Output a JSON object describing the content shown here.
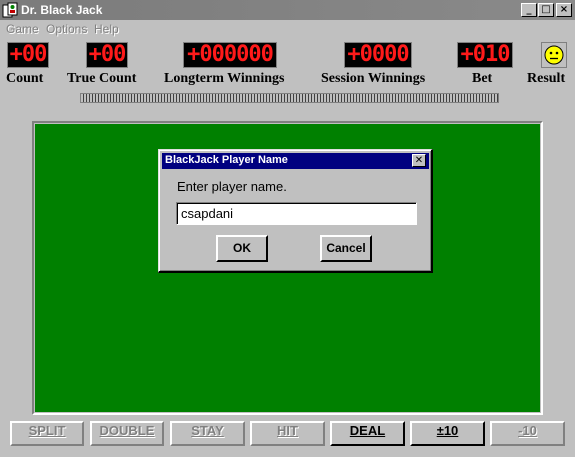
{
  "window": {
    "title": "Dr. Black Jack",
    "minimize_glyph": "_",
    "maximize_glyph": "□",
    "close_glyph": "×"
  },
  "menu": {
    "items": [
      "Game",
      "Options",
      "Help"
    ]
  },
  "displays": {
    "count": {
      "label": "Count",
      "value": "+00"
    },
    "true_count": {
      "label": "True Count",
      "value": "+00"
    },
    "longterm_winnings": {
      "label": "Longterm Winnings",
      "value": "+000000"
    },
    "session_winnings": {
      "label": "Session Winnings",
      "value": "+0000"
    },
    "bet": {
      "label": "Bet",
      "value": "+010"
    },
    "result": {
      "label": "Result",
      "icon": "neutral-face-icon"
    }
  },
  "dialog": {
    "title": "BlackJack Player Name",
    "prompt": "Enter player name.",
    "input_value": "csapdani",
    "ok_label": "OK",
    "cancel_label": "Cancel"
  },
  "buttons": {
    "split": "SPLIT",
    "double": "DOUBLE",
    "stay": "STAY",
    "hit": "HIT",
    "deal": "DEAL",
    "plus10": "±10",
    "minus10": "-10"
  },
  "colors": {
    "table_felt": "#008000",
    "led_text": "#ff1a1a",
    "dialog_title": "#000080"
  }
}
